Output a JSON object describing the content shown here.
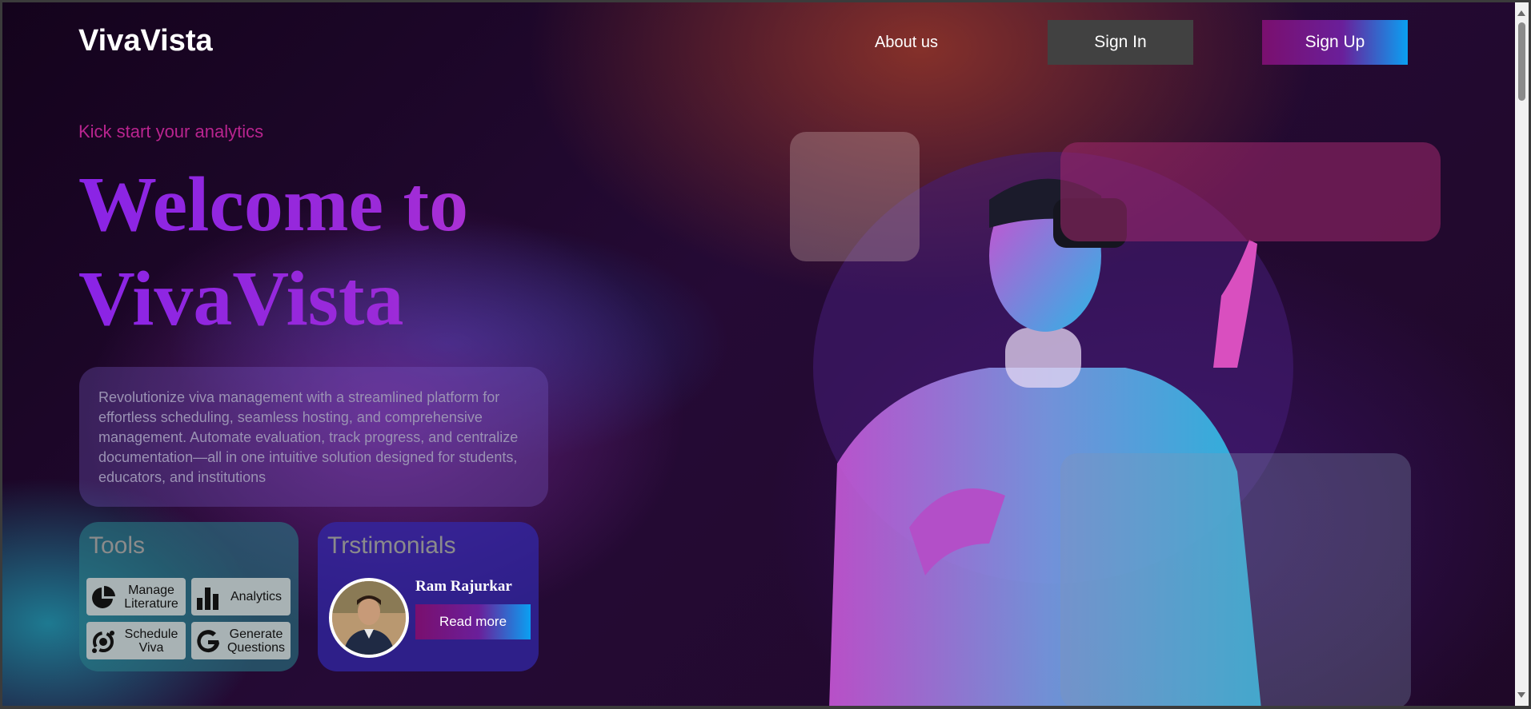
{
  "brand": {
    "name": "VivaVista"
  },
  "nav": {
    "about": "About us",
    "signin": "Sign In",
    "signup": "Sign Up"
  },
  "hero": {
    "tagline": "Kick start your analytics",
    "title_line1": "Welcome to",
    "title_line2": "VivaVista",
    "description": "Revolutionize viva management with a streamlined platform for effortless scheduling, seamless hosting, and comprehensive management. Automate evaluation, track progress, and centralize documentation—all in one intuitive solution designed for students, educators, and institutions"
  },
  "tools": {
    "title": "Tools",
    "items": [
      {
        "label": "Manage Literature",
        "icon": "pie-chart-icon"
      },
      {
        "label": "Analytics",
        "icon": "bar-chart-icon"
      },
      {
        "label": "Schedule Viva",
        "icon": "schedule-icon"
      },
      {
        "label": "Generate Questions",
        "icon": "google-icon"
      }
    ]
  },
  "testimonials": {
    "title": "Trstimonials",
    "name": "Ram Rajurkar",
    "read_more": "Read more"
  },
  "colors": {
    "accent_gradient_start": "#7a0f6e",
    "accent_gradient_end": "#0aa0f2",
    "tagline": "#b9248f",
    "title_purple": "#8a24e6"
  }
}
